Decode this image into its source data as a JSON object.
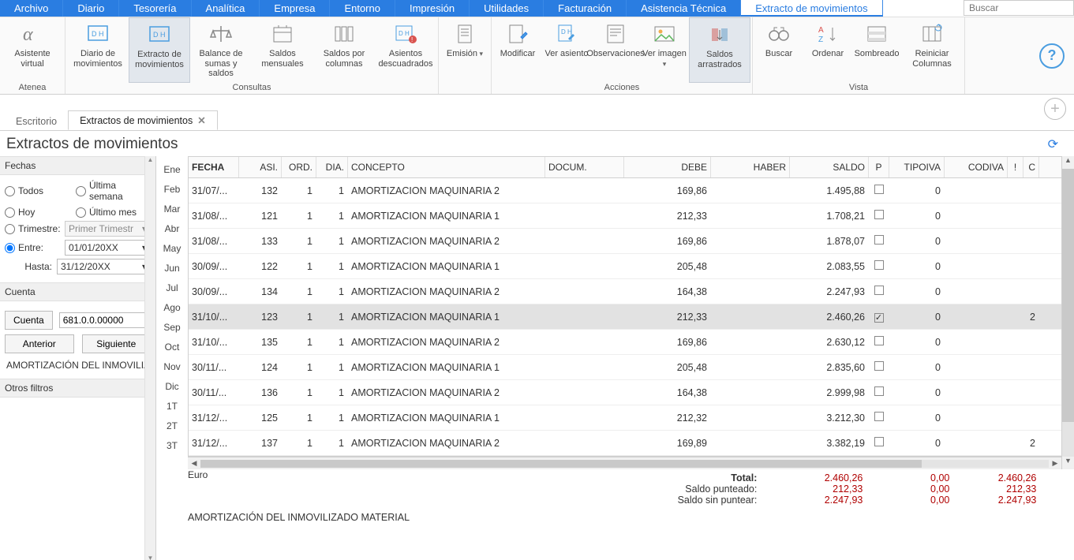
{
  "menu": [
    "Archivo",
    "Diario",
    "Tesorería",
    "Analítica",
    "Empresa",
    "Entorno",
    "Impresión",
    "Utilidades",
    "Facturación",
    "Asistencia Técnica"
  ],
  "ribbon_tab_active": "Extracto de movimientos",
  "search_placeholder": "Buscar",
  "ribbon_groups": {
    "atenea": {
      "label": "Atenea",
      "buttons": [
        {
          "label": "Asistente virtual",
          "icon": "alpha"
        }
      ]
    },
    "consultas": {
      "label": "Consultas",
      "buttons": [
        {
          "label": "Diario de movimientos",
          "icon": "doc-dh"
        },
        {
          "label": "Extracto de movimientos",
          "icon": "doc-dh",
          "active": true
        },
        {
          "label": "Balance de sumas y saldos",
          "icon": "scales"
        },
        {
          "label": "Saldos mensuales",
          "icon": "calendar"
        },
        {
          "label": "Saldos por columnas",
          "icon": "columns"
        },
        {
          "label": "Asientos descuadrados",
          "icon": "doc-dh-exc"
        }
      ]
    },
    "blank1": {
      "label": "",
      "buttons": [
        {
          "label": "Emisión",
          "icon": "doc",
          "drop": true
        }
      ]
    },
    "acciones": {
      "label": "Acciones",
      "buttons": [
        {
          "label": "Modificar",
          "icon": "doc-edit"
        },
        {
          "label": "Ver asiento",
          "icon": "doc-dh-view"
        },
        {
          "label": "Observaciones",
          "icon": "doc-lines"
        },
        {
          "label": "Ver imagen",
          "icon": "image",
          "drop": true
        },
        {
          "label": "Saldos arrastrados",
          "icon": "saldos",
          "active": true
        }
      ]
    },
    "vista": {
      "label": "Vista",
      "buttons": [
        {
          "label": "Buscar",
          "icon": "binoculars"
        },
        {
          "label": "Ordenar",
          "icon": "azsort"
        },
        {
          "label": "Sombreado",
          "icon": "shade"
        },
        {
          "label": "Reiniciar Columnas",
          "icon": "resetcols"
        }
      ]
    }
  },
  "doc_tabs": [
    {
      "label": "Escritorio",
      "active": false,
      "closable": false
    },
    {
      "label": "Extractos de movimientos",
      "active": true,
      "closable": true
    }
  ],
  "page_title": "Extractos de movimientos",
  "sidebar": {
    "fechas_label": "Fechas",
    "radios": {
      "todos": "Todos",
      "ultima_semana": "Última semana",
      "hoy": "Hoy",
      "ultimo_mes": "Último mes",
      "trimestre": "Trimestre:",
      "entre": "Entre:"
    },
    "trimestre_value": "Primer Trimestr",
    "entre_value": "01/01/20XX",
    "hasta_label": "Hasta:",
    "hasta_value": "31/12/20XX",
    "cuenta_label": "Cuenta",
    "cuenta_btn": "Cuenta",
    "cuenta_value": "681.0.0.00000",
    "anterior": "Anterior",
    "siguiente": "Siguiente",
    "account_desc": "AMORTIZACIÓN DEL INMOVILIZAD",
    "otros_filtros": "Otros filtros"
  },
  "months": [
    "Ene",
    "Feb",
    "Mar",
    "Abr",
    "May",
    "Jun",
    "Jul",
    "Ago",
    "Sep",
    "Oct",
    "Nov",
    "Dic",
    "1T",
    "2T",
    "3T"
  ],
  "grid": {
    "headers": {
      "fecha": "FECHA",
      "asi": "ASI.",
      "ord": "ORD.",
      "dia": "DIA.",
      "concepto": "CONCEPTO",
      "docum": "DOCUM.",
      "debe": "DEBE",
      "haber": "HABER",
      "saldo": "SALDO",
      "p": "P",
      "tipoiva": "TIPOIVA",
      "codiva": "CODIVA",
      "bang": "!",
      "last": "C"
    },
    "rows": [
      {
        "fecha": "31/07/...",
        "asi": "132",
        "ord": "1",
        "dia": "1",
        "concepto": "AMORTIZACION MAQUINARIA 2",
        "docum": "",
        "debe": "169,86",
        "haber": "",
        "saldo": "1.495,88",
        "p": false,
        "tipoiva": "0",
        "codiva": "",
        "last": ""
      },
      {
        "fecha": "31/08/...",
        "asi": "121",
        "ord": "1",
        "dia": "1",
        "concepto": "AMORTIZACION MAQUINARIA 1",
        "docum": "",
        "debe": "212,33",
        "haber": "",
        "saldo": "1.708,21",
        "p": false,
        "tipoiva": "0",
        "codiva": "",
        "last": ""
      },
      {
        "fecha": "31/08/...",
        "asi": "133",
        "ord": "1",
        "dia": "1",
        "concepto": "AMORTIZACION MAQUINARIA 2",
        "docum": "",
        "debe": "169,86",
        "haber": "",
        "saldo": "1.878,07",
        "p": false,
        "tipoiva": "0",
        "codiva": "",
        "last": ""
      },
      {
        "fecha": "30/09/...",
        "asi": "122",
        "ord": "1",
        "dia": "1",
        "concepto": "AMORTIZACION MAQUINARIA 1",
        "docum": "",
        "debe": "205,48",
        "haber": "",
        "saldo": "2.083,55",
        "p": false,
        "tipoiva": "0",
        "codiva": "",
        "last": ""
      },
      {
        "fecha": "30/09/...",
        "asi": "134",
        "ord": "1",
        "dia": "1",
        "concepto": "AMORTIZACION MAQUINARIA 2",
        "docum": "",
        "debe": "164,38",
        "haber": "",
        "saldo": "2.247,93",
        "p": false,
        "tipoiva": "0",
        "codiva": "",
        "last": ""
      },
      {
        "fecha": "31/10/...",
        "asi": "123",
        "ord": "1",
        "dia": "1",
        "concepto": "AMORTIZACION MAQUINARIA 1",
        "docum": "",
        "debe": "212,33",
        "haber": "",
        "saldo": "2.460,26",
        "p": true,
        "tipoiva": "0",
        "codiva": "",
        "last": "2",
        "sel": true
      },
      {
        "fecha": "31/10/...",
        "asi": "135",
        "ord": "1",
        "dia": "1",
        "concepto": "AMORTIZACION MAQUINARIA 2",
        "docum": "",
        "debe": "169,86",
        "haber": "",
        "saldo": "2.630,12",
        "p": false,
        "tipoiva": "0",
        "codiva": "",
        "last": ""
      },
      {
        "fecha": "30/11/...",
        "asi": "124",
        "ord": "1",
        "dia": "1",
        "concepto": "AMORTIZACION MAQUINARIA 1",
        "docum": "",
        "debe": "205,48",
        "haber": "",
        "saldo": "2.835,60",
        "p": false,
        "tipoiva": "0",
        "codiva": "",
        "last": ""
      },
      {
        "fecha": "30/11/...",
        "asi": "136",
        "ord": "1",
        "dia": "1",
        "concepto": "AMORTIZACION MAQUINARIA 2",
        "docum": "",
        "debe": "164,38",
        "haber": "",
        "saldo": "2.999,98",
        "p": false,
        "tipoiva": "0",
        "codiva": "",
        "last": ""
      },
      {
        "fecha": "31/12/...",
        "asi": "125",
        "ord": "1",
        "dia": "1",
        "concepto": "AMORTIZACION MAQUINARIA 1",
        "docum": "",
        "debe": "212,32",
        "haber": "",
        "saldo": "3.212,30",
        "p": false,
        "tipoiva": "0",
        "codiva": "",
        "last": ""
      },
      {
        "fecha": "31/12/...",
        "asi": "137",
        "ord": "1",
        "dia": "1",
        "concepto": "AMORTIZACION MAQUINARIA 2",
        "docum": "",
        "debe": "169,89",
        "haber": "",
        "saldo": "3.382,19",
        "p": false,
        "tipoiva": "0",
        "codiva": "",
        "last": "2"
      }
    ]
  },
  "currency": "Euro",
  "totals": {
    "total_label": "Total:",
    "total_debe": "2.460,26",
    "total_haber": "0,00",
    "total_saldo": "2.460,26",
    "punteado_label": "Saldo punteado:",
    "punteado_debe": "212,33",
    "punteado_haber": "0,00",
    "punteado_saldo": "212,33",
    "sinpuntear_label": "Saldo sin puntear:",
    "sinpuntear_debe": "2.247,93",
    "sinpuntear_haber": "0,00",
    "sinpuntear_saldo": "2.247,93"
  },
  "footer_desc": "AMORTIZACIÓN DEL INMOVILIZADO MATERIAL"
}
